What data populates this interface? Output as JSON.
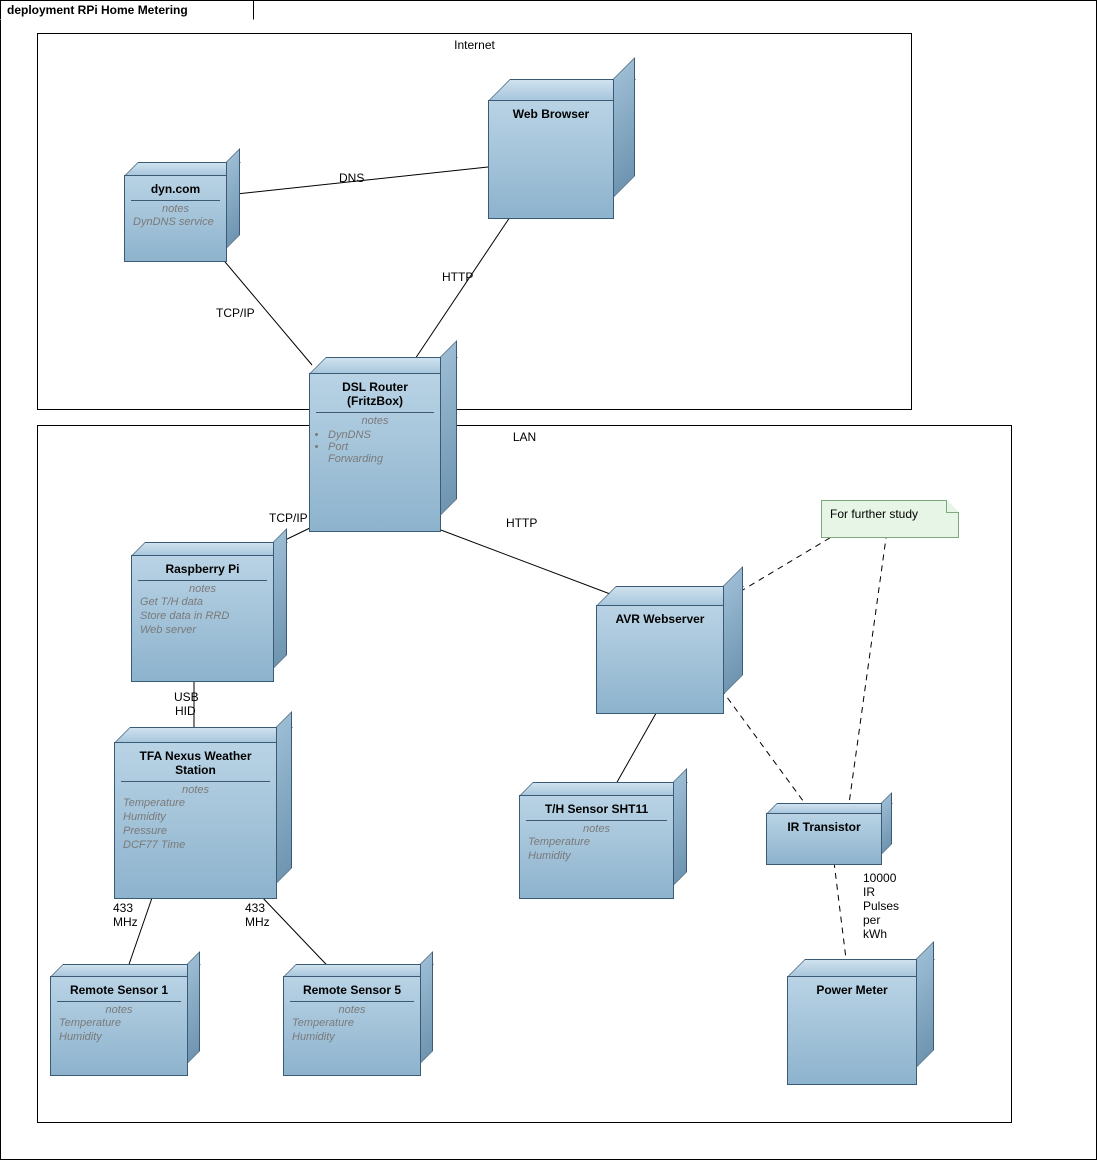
{
  "diagram": {
    "frame_label": "deployment RPi Home Metering",
    "regions": {
      "internet": "Internet",
      "lan": "LAN"
    },
    "note": "For further study",
    "nodes": {
      "dyn": {
        "title": "dyn.com",
        "notes_hd": "notes",
        "n1": "DynDNS service"
      },
      "browser": {
        "title": "Web Browser"
      },
      "router": {
        "title1": "DSL Router",
        "title2": "(FritzBox)",
        "notes_hd": "notes",
        "li1": "DynDNS",
        "li2": "Port",
        "li3": "Forwarding"
      },
      "rpi": {
        "title": "Raspberry Pi",
        "notes_hd": "notes",
        "n1": "Get T/H data",
        "n2": "Store data in RRD",
        "n3": "Web server"
      },
      "tfa": {
        "title1": "TFA Nexus Weather",
        "title2": "Station",
        "notes_hd": "notes",
        "n1": "Temperature",
        "n2": "Humidity",
        "n3": "Pressure",
        "n4": "DCF77 Time"
      },
      "rs1": {
        "title": "Remote Sensor 1",
        "notes_hd": "notes",
        "n1": "Temperature",
        "n2": "Humidity"
      },
      "rs5": {
        "title": "Remote Sensor 5",
        "notes_hd": "notes",
        "n1": "Temperature",
        "n2": "Humidity"
      },
      "avr": {
        "title": "AVR Webserver"
      },
      "sht": {
        "title": "T/H Sensor SHT11",
        "notes_hd": "notes",
        "n1": "Temperature",
        "n2": "Humidity"
      },
      "ir": {
        "title": "IR Transistor"
      },
      "pm": {
        "title": "Power Meter"
      }
    },
    "labels": {
      "dns": "DNS",
      "http1": "HTTP",
      "tcpip1": "TCP/IP",
      "tcpip2": "TCP/IP",
      "http2": "HTTP",
      "usb": "USB",
      "hid": "HID",
      "m433a": "433",
      "mhza": "MHz",
      "m433b": "433",
      "mhzb": "MHz",
      "ir1": "10000",
      "ir2": "IR",
      "ir3": "Pulses",
      "ir4": "per",
      "ir5": "kWh"
    }
  }
}
